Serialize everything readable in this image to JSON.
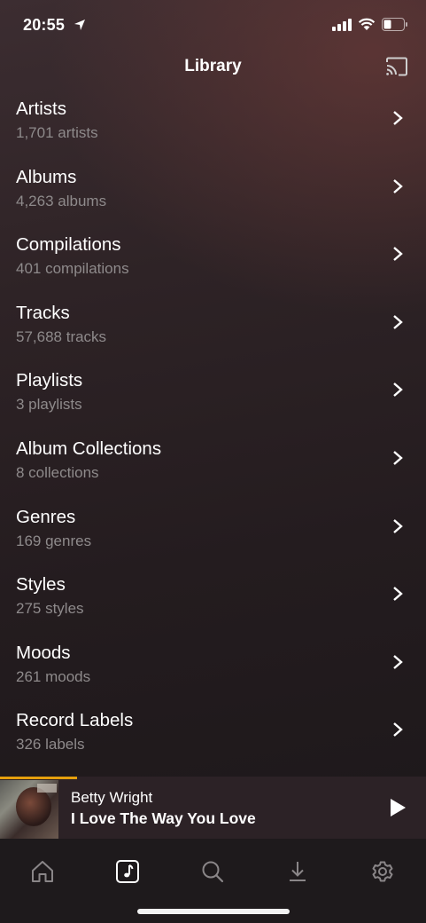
{
  "status_bar": {
    "time": "20:55"
  },
  "nav": {
    "title": "Library"
  },
  "library_items": [
    {
      "title": "Artists",
      "subtitle": "1,701 artists"
    },
    {
      "title": "Albums",
      "subtitle": "4,263 albums"
    },
    {
      "title": "Compilations",
      "subtitle": "401 compilations"
    },
    {
      "title": "Tracks",
      "subtitle": "57,688 tracks"
    },
    {
      "title": "Playlists",
      "subtitle": "3 playlists"
    },
    {
      "title": "Album Collections",
      "subtitle": "8 collections"
    },
    {
      "title": "Genres",
      "subtitle": "169 genres"
    },
    {
      "title": "Styles",
      "subtitle": "275 styles"
    },
    {
      "title": "Moods",
      "subtitle": "261 moods"
    },
    {
      "title": "Record Labels",
      "subtitle": "326 labels"
    }
  ],
  "now_playing": {
    "artist": "Betty Wright",
    "track": "I Love The Way You Love",
    "progress_fraction": 0.18
  },
  "tabs": [
    {
      "icon": "home-icon",
      "active": false
    },
    {
      "icon": "music-library-icon",
      "active": true
    },
    {
      "icon": "search-icon",
      "active": false
    },
    {
      "icon": "download-icon",
      "active": false
    },
    {
      "icon": "settings-gear-icon",
      "active": false
    }
  ],
  "colors": {
    "accent_progress": "#e5a00d",
    "subtitle_gray": "#8e8a8b",
    "tab_inactive": "#8a8688"
  }
}
